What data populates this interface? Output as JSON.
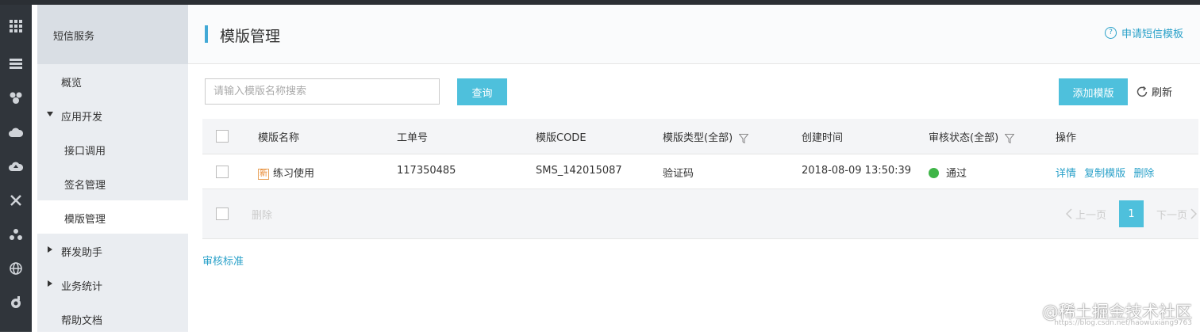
{
  "sidebar": {
    "header": "短信服务",
    "items": [
      {
        "label": "概览"
      },
      {
        "label": "应用开发"
      },
      {
        "label": "接口调用"
      },
      {
        "label": "签名管理"
      },
      {
        "label": "模版管理"
      },
      {
        "label": "群发助手"
      },
      {
        "label": "业务统计"
      },
      {
        "label": "帮助文档"
      }
    ]
  },
  "iconbar": [
    "grid-icon",
    "server-icon",
    "cluster-icon",
    "cloud-icon",
    "cloud-upload-icon",
    "network-icon",
    "tree-icon",
    "globe-icon",
    "cog-icon"
  ],
  "page": {
    "title": "模版管理",
    "apply_link": "申请短信模板"
  },
  "toolbar": {
    "search_placeholder": "请输入模版名称搜索",
    "query_label": "查询",
    "add_label": "添加模版",
    "refresh_label": "刷新"
  },
  "table": {
    "columns": [
      "模版名称",
      "工单号",
      "模版CODE",
      "模版类型(全部)",
      "创建时间",
      "审核状态(全部)",
      "操作"
    ],
    "rows": [
      {
        "new_tag": "新",
        "name": "练习使用",
        "ticket": "117350485",
        "code": "SMS_142015087",
        "type": "验证码",
        "created": "2018-08-09 13:50:39",
        "status": "通过",
        "actions": [
          "详情",
          "复制模版",
          "删除"
        ]
      }
    ],
    "footer": {
      "delete_label": "删除",
      "prev_label": "上一页",
      "page": "1",
      "next_label": "下一页"
    }
  },
  "audit_link": "审核标准",
  "watermark": "@稀土掘金技术社区",
  "watermark_url": "https://blog.csdn.net/haowuxiang9763",
  "colors": {
    "accent": "#4ec0dc",
    "link": "#2aa1c9",
    "success": "#3fb548",
    "iconbar": "#30353b"
  }
}
